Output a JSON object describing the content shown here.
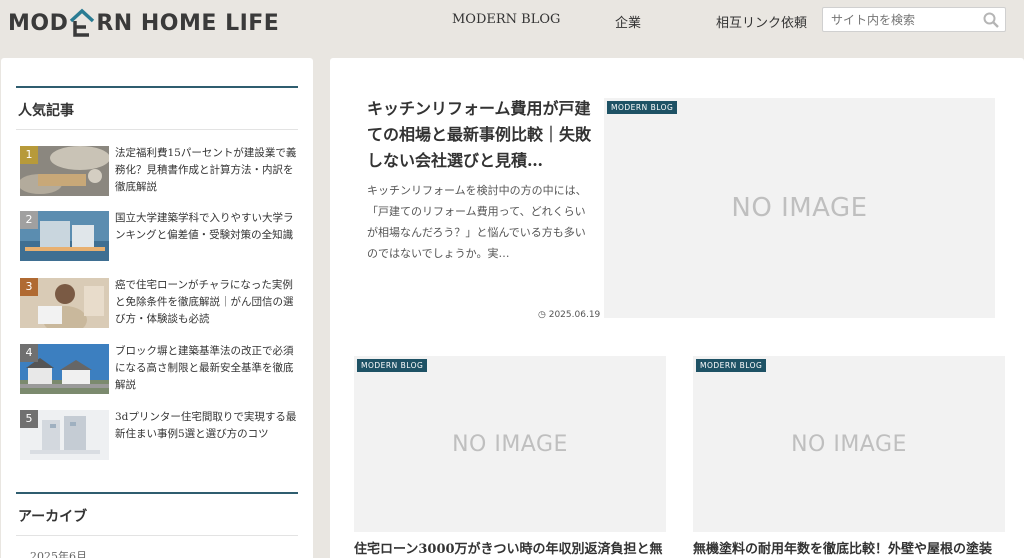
{
  "header": {
    "logo": {
      "pre": "MOD",
      "post": "RN HOME LIFE"
    },
    "nav": [
      "MODERN BLOG",
      "企業",
      "相互リンク依頼"
    ],
    "search_placeholder": "サイト内を検索"
  },
  "sidebar": {
    "popular_title": "人気記事",
    "items": [
      {
        "rank": "1",
        "title": "法定福利費15パーセントが建設業で義務化？見積書作成と計算方法・内訳を徹底解説",
        "color": "#b79a3a"
      },
      {
        "rank": "2",
        "title": "国立大学建築学科で入りやすい大学ランキングと偏差値・受験対策の全知識",
        "color": "#a0a0a0"
      },
      {
        "rank": "3",
        "title": "癌で住宅ローンがチャラになった実例と免除条件を徹底解説｜がん団信の選び方・体験談も必読",
        "color": "#b06a32"
      },
      {
        "rank": "4",
        "title": "ブロック塀と建築基準法の改正で必須になる高さ制限と最新安全基準を徹底解説",
        "color": "#707070"
      },
      {
        "rank": "5",
        "title": "3dプリンター住宅間取りで実現する最新住まい事例5選と選び方のコツ",
        "color": "#707070"
      }
    ],
    "archive_title": "アーカイブ",
    "archive_item": "2025年6月"
  },
  "featured": {
    "category": "MODERN BLOG",
    "title": "キッチンリフォーム費用が戸建ての相場と最新事例比較｜失敗しない会社選びと見積…",
    "excerpt": "キッチンリフォームを検討中の方の中には、「戸建てのリフォーム費用って、どれくらいが相場なんだろう？」と悩んでいる方も多いのではないでしょうか。実…",
    "date": "2025.06.19",
    "noimage": "NO IMAGE"
  },
  "cards": [
    {
      "category": "MODERN BLOG",
      "noimage": "NO IMAGE",
      "title": "住宅ローン3000万がきつい時の年収別返済負担と無"
    },
    {
      "category": "MODERN BLOG",
      "noimage": "NO IMAGE",
      "title": "無機塗料の耐用年数を徹底比較！外壁や屋根の塗装"
    }
  ],
  "colors": {
    "accent": "#2f5d6f",
    "badge": "#1e5265",
    "page_bg": "#e9e6e1"
  }
}
